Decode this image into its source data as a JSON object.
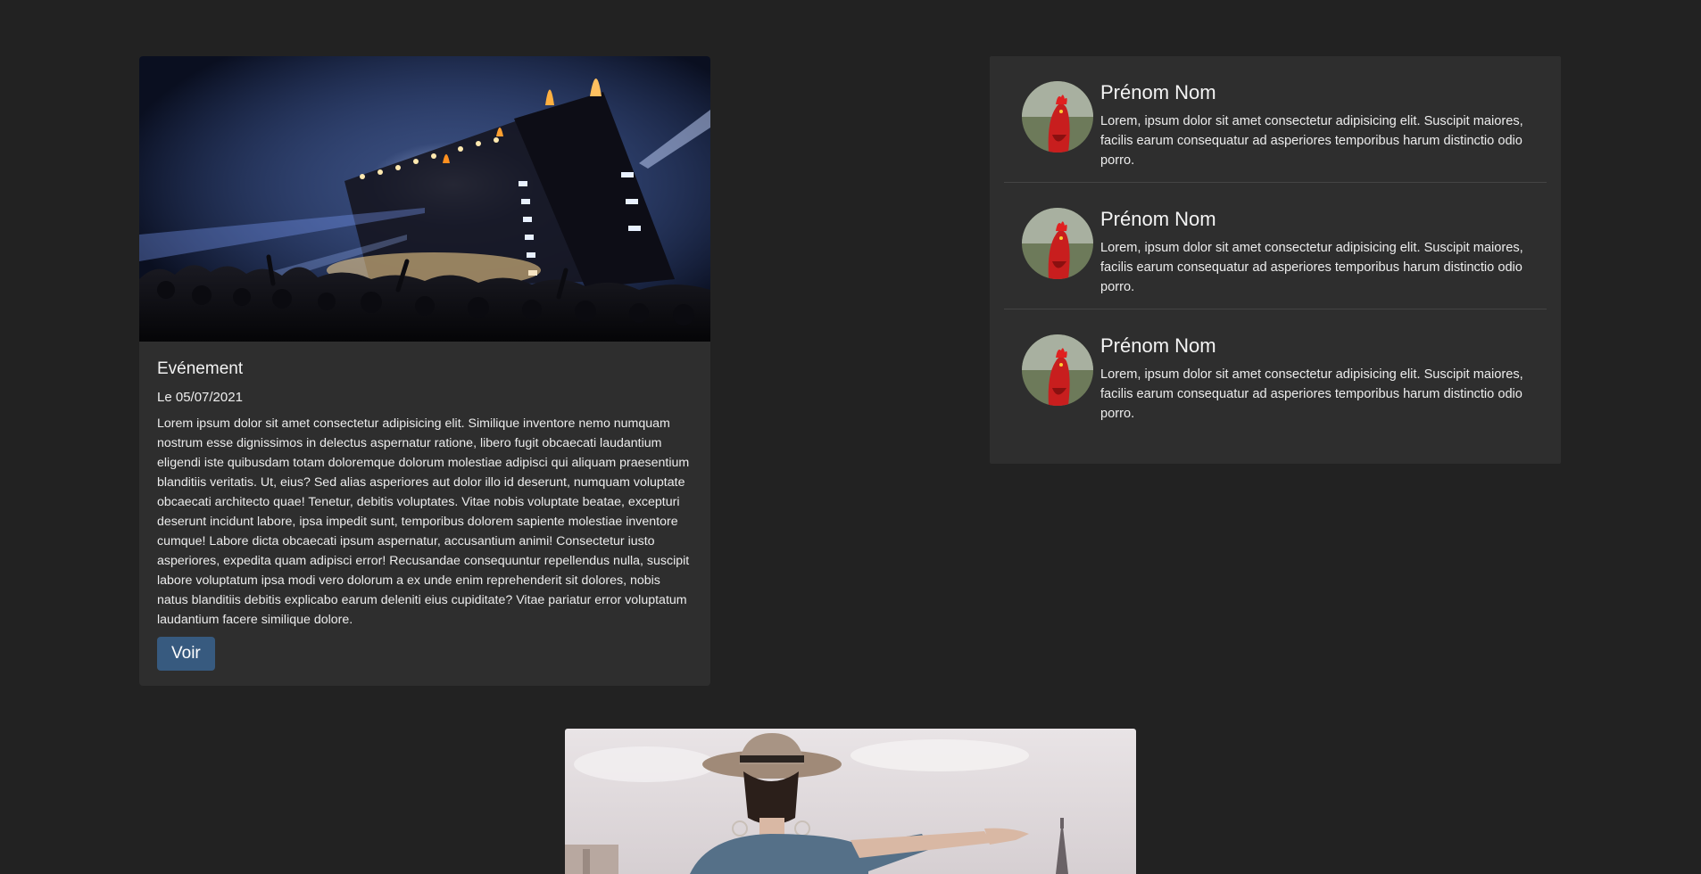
{
  "event": {
    "image_alt": "concert-photo",
    "title": "Evénement",
    "date": "Le 05/07/2021",
    "text": "Lorem ipsum dolor sit amet consectetur adipisicing elit. Similique inventore nemo numquam nostrum esse dignissimos in delectus aspernatur ratione, libero fugit obcaecati laudantium eligendi iste quibusdam totam doloremque dolorum molestiae adipisci qui aliquam praesentium blanditiis veritatis. Ut, eius? Sed alias asperiores aut dolor illo id deserunt, numquam voluptate obcaecati architecto quae! Tenetur, debitis voluptates. Vitae nobis voluptate beatae, excepturi deserunt incidunt labore, ipsa impedit sunt, temporibus dolorem sapiente molestiae inventore cumque! Labore dicta obcaecati ipsum aspernatur, accusantium animi! Consectetur iusto asperiores, expedita quam adipisci error! Recusandae consequuntur repellendus nulla, suscipit labore voluptatum ipsa modi vero dolorum a ex unde enim reprehenderit sit dolores, nobis natus blanditiis debitis explicabo earum deleniti eius cupiditate? Vitae pariatur error voluptatum laudantium facere similique dolore.",
    "button_label": "Voir"
  },
  "profiles": [
    {
      "name": "Prénom Nom",
      "text": "Lorem, ipsum dolor sit amet consectetur adipisicing elit. Suscipit maiores, facilis earum consequatur ad asperiores temporibus harum distinctio odio porro."
    },
    {
      "name": "Prénom Nom",
      "text": "Lorem, ipsum dolor sit amet consectetur adipisicing elit. Suscipit maiores, facilis earum consequatur ad asperiores temporibus harum distinctio odio porro."
    },
    {
      "name": "Prénom Nom",
      "text": "Lorem, ipsum dolor sit amet consectetur adipisicing elit. Suscipit maiores, facilis earum consequatur ad asperiores temporibus harum distinctio odio porro."
    }
  ],
  "colors": {
    "background": "#222222",
    "card": "#2e2e2e",
    "button": "#375a7f"
  }
}
